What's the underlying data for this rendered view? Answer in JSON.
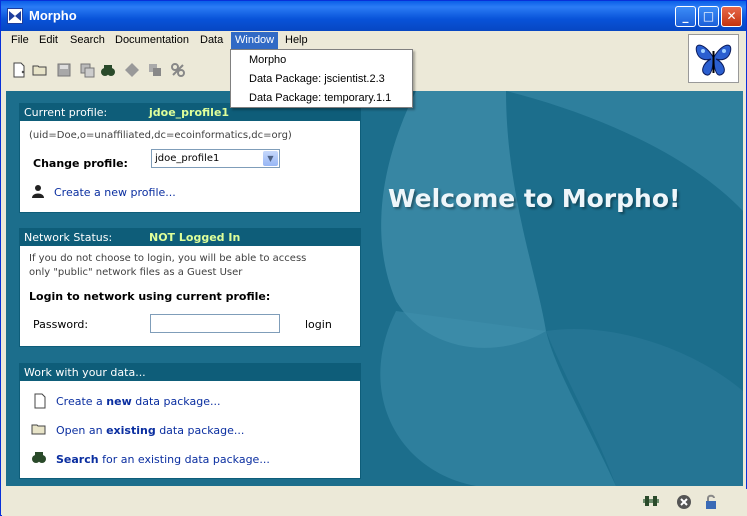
{
  "window": {
    "title": "Morpho"
  },
  "menubar": {
    "items": [
      "File",
      "Edit",
      "Search",
      "Documentation",
      "Data",
      "Window",
      "Help"
    ]
  },
  "window_menu": {
    "items": [
      "Morpho",
      "Data Package: jscientist.2.3",
      "Data Package: temporary.1.1"
    ]
  },
  "profile_panel": {
    "header_label": "Current profile:",
    "header_value": "jdoe_profile1",
    "uid": "(uid=Doe,o=unaffiliated,dc=ecoinformatics,dc=org)",
    "change_label": "Change profile:",
    "selected": "jdoe_profile1",
    "create_link": "Create a new profile..."
  },
  "network_panel": {
    "header_label": "Network Status:",
    "header_value": "NOT Logged In",
    "info_line1": "If you do not choose to login, you will be able to access",
    "info_line2": "only \"public\" network files as a Guest User",
    "login_heading": "Login to network using current profile:",
    "password_label": "Password:",
    "login_button": "login"
  },
  "data_panel": {
    "header_label": "Work with your data...",
    "create_pre": "Create a ",
    "create_bold": "new",
    "create_post": " data package...",
    "open_pre": "Open an ",
    "open_bold": "existing",
    "open_post": " data package...",
    "search_bold": "Search",
    "search_post": " for an existing data package..."
  },
  "welcome_text": "Welcome to Morpho!",
  "colors": {
    "title_bar": "#0a5fe8",
    "main_bg": "#1c6e8c",
    "panel_header": "#0e5d79",
    "header_value": "#dfff9a",
    "link": "#0a2ea0"
  }
}
